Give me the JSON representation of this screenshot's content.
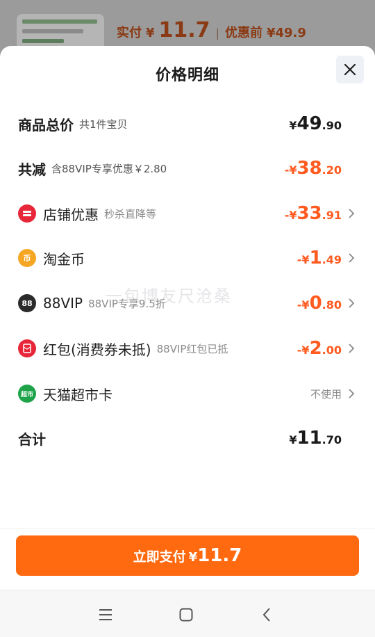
{
  "background": {
    "price_label": "实付",
    "price_currency": "¥",
    "price_value": "11.7",
    "separator": "|",
    "original_label": "优惠前",
    "original_price": "¥49.9"
  },
  "sheet": {
    "title": "价格明细",
    "close_icon": "close-icon"
  },
  "rows": {
    "total": {
      "label": "商品总价",
      "sub": "共1件宝贝",
      "currency": "¥",
      "int": "49",
      "dec": ".90"
    },
    "reduce": {
      "label": "共减",
      "sub": "含88VIP专享优惠￥2.80",
      "currency": "-¥",
      "int": "38",
      "dec": ".20"
    },
    "store": {
      "label": "店铺优惠",
      "sub": "秒杀直降等",
      "currency": "-¥",
      "int": "33",
      "dec": ".91",
      "icon_text": "",
      "icon_color": "#e8263a"
    },
    "coin": {
      "label": "淘金币",
      "currency": "-¥",
      "int": "1",
      "dec": ".49",
      "icon_text": "币",
      "icon_color": "#f5a623"
    },
    "vip": {
      "label": "88VIP",
      "sub": "88VIP专享9.5折",
      "currency": "-¥",
      "int": "0",
      "dec": ".80",
      "icon_text": "88",
      "icon_color": "#2b2b2b"
    },
    "redpacket": {
      "label": "红包(消费券未抵)",
      "sub": "88VIP红包已抵",
      "currency": "-¥",
      "int": "2",
      "dec": ".00",
      "icon_text": "",
      "icon_color": "#e8263a"
    },
    "card": {
      "label": "天猫超市卡",
      "status": "不使用",
      "icon_text": "超市",
      "icon_color": "#1fa34a"
    },
    "sum": {
      "label": "合计",
      "currency": "¥",
      "int": "11",
      "dec": ".70"
    }
  },
  "watermark": "一包博友尺沧桑",
  "footer": {
    "pay_label": "立即支付",
    "pay_currency": "¥",
    "pay_amount": "11.7"
  },
  "colors": {
    "accent": "#ff6a10",
    "discount": "#ff5a1f"
  }
}
